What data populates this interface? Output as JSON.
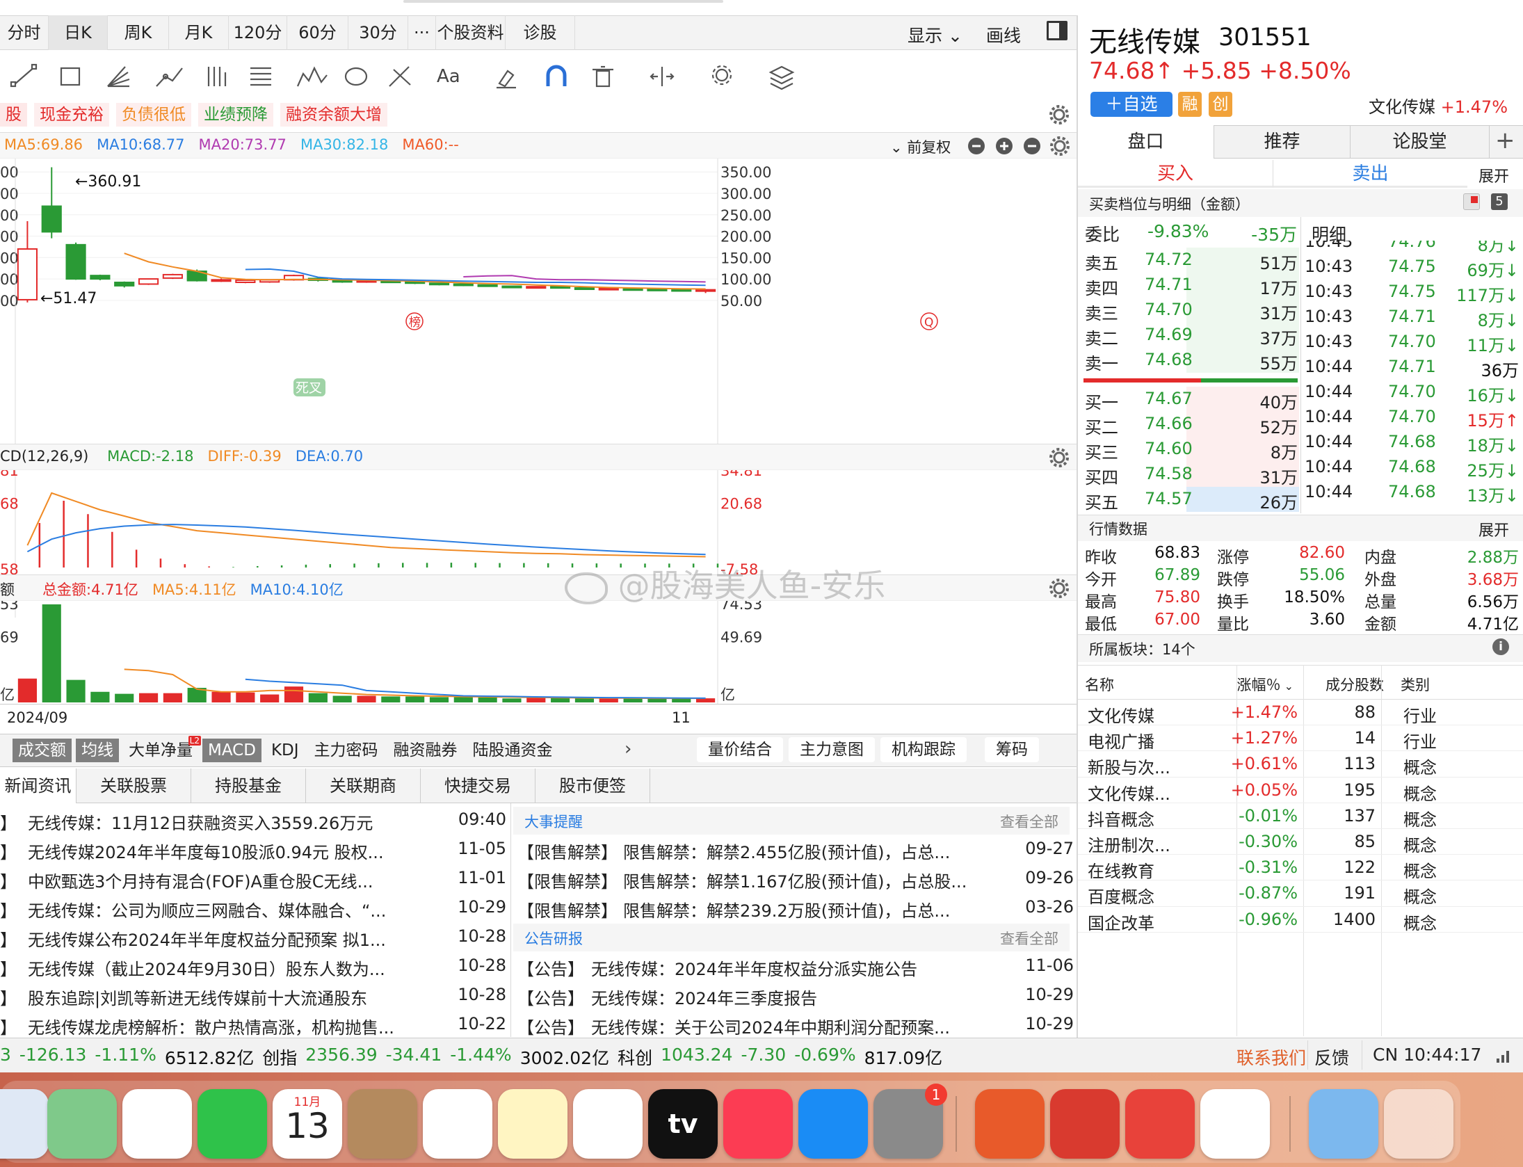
{
  "period_tabs": [
    "分时",
    "日K",
    "周K",
    "月K",
    "120分",
    "60分",
    "30分",
    "···",
    "个股资料",
    "诊股"
  ],
  "toolbar_right": {
    "display": "显示",
    "draw": "画线"
  },
  "tags": [
    "股",
    "现金充裕",
    "负债很低",
    "业绩预降",
    "融资余额大增"
  ],
  "ma": {
    "ma5": "MA5:69.86",
    "ma10": "MA10:68.77",
    "ma20": "MA20:73.77",
    "ma30": "MA30:82.18",
    "ma60": "MA60:--",
    "adjust": "前复权"
  },
  "kline": {
    "high_label": "←360.91",
    "low_label": "←51.47",
    "axis": [
      "350.00",
      "300.00",
      "250.00",
      "200.00",
      "150.00",
      "100.00",
      "50.00"
    ],
    "left_axis": [
      "00",
      "00",
      "00",
      "00",
      "00",
      "00",
      "00"
    ],
    "marker1": "榜",
    "marker2": "Q"
  },
  "macd": {
    "title": "CD(12,26,9)",
    "macd": "MACD:-2.18",
    "diff": "DIFF:-0.39",
    "dea": "DEA:0.70",
    "axis": [
      "34.81",
      "20.68",
      "-7.58"
    ],
    "left_axis": [
      "81",
      "68",
      "58"
    ],
    "cross": "死叉"
  },
  "volume": {
    "title": "额",
    "total": "总金额:4.71亿",
    "ma5": "MA5:4.11亿",
    "ma10": "MA10:4.10亿",
    "axis": [
      "74.53",
      "49.69",
      "亿"
    ],
    "left_axis": [
      "53",
      "69",
      "亿"
    ]
  },
  "x_axis": [
    "2024/09",
    "11"
  ],
  "indicator_tabs": [
    "成交额",
    "均线",
    "大单净量",
    "MACD",
    "KDJ",
    "主力密码",
    "融资融券",
    "陆股通资金"
  ],
  "indicator_badge": "L2",
  "indicator_right": [
    "量价结合",
    "主力意图",
    "机构跟踪",
    "筹码"
  ],
  "news_tabs": [
    "新闻资讯",
    "关联股票",
    "持股基金",
    "关联期商",
    "快捷交易",
    "股市便签"
  ],
  "news": [
    {
      "title": "无线传媒：11月12日获融资买入3559.26万元",
      "date": "09:40"
    },
    {
      "title": "无线传媒2024年半年度每10股派0.94元 股权...",
      "date": "11-05"
    },
    {
      "title": "中欧甄选3个月持有混合(FOF)A重仓股C无线...",
      "date": "11-01"
    },
    {
      "title": "无线传媒：公司为顺应三网融合、媒体融合、“...",
      "date": "10-29"
    },
    {
      "title": "无线传媒公布2024年半年度权益分配预案 拟1...",
      "date": "10-28"
    },
    {
      "title": "无线传媒（截止2024年9月30日）股东人数为...",
      "date": "10-28"
    },
    {
      "title": "股东追踪|刘凯等新进无线传媒前十大流通股东",
      "date": "10-28"
    },
    {
      "title": "无线传媒龙虎榜解析：散户热情高涨，机构抛售...",
      "date": "10-22"
    }
  ],
  "events": {
    "title": "大事提醒",
    "more": "查看全部",
    "items": [
      {
        "tag": "【限售解禁】",
        "text": "限售解禁：解禁2.455亿股(预计值)，占总...",
        "date": "09-27"
      },
      {
        "tag": "【限售解禁】",
        "text": "限售解禁：解禁1.167亿股(预计值)，占总股...",
        "date": "09-26"
      },
      {
        "tag": "【限售解禁】",
        "text": "限售解禁：解禁239.2万股(预计值)，占总...",
        "date": "03-26"
      }
    ]
  },
  "notices": {
    "title": "公告研报",
    "more": "查看全部",
    "items": [
      {
        "tag": "【公告】",
        "text": "无线传媒：2024年半年度权益分派实施公告",
        "date": "11-06"
      },
      {
        "tag": "【公告】",
        "text": "无线传媒：2024年三季度报告",
        "date": "10-29"
      },
      {
        "tag": "【公告】",
        "text": "无线传媒：关于公司2024年中期利润分配预案...",
        "date": "10-29"
      }
    ]
  },
  "stock": {
    "name": "无线传媒",
    "code": "301551",
    "price": "74.68↑",
    "change": "+5.85",
    "pct": "+8.50%",
    "add_watch": "＋自选",
    "badge1": "融",
    "badge2": "创",
    "sector": "文化传媒",
    "sector_pct": "+1.47%"
  },
  "right_tabs": [
    "盘口",
    "推荐",
    "论股堂"
  ],
  "buy": "买入",
  "sell": "卖出",
  "expand": "展开",
  "book_title": "买卖档位与明细（金额）",
  "book_count": "5",
  "weibi": {
    "label": "委比",
    "pct": "-9.83%",
    "amt": "-35万"
  },
  "detail_title": "明细",
  "asks": [
    {
      "l": "卖五",
      "p": "74.72",
      "v": "51万"
    },
    {
      "l": "卖四",
      "p": "74.71",
      "v": "17万"
    },
    {
      "l": "卖三",
      "p": "74.70",
      "v": "31万"
    },
    {
      "l": "卖二",
      "p": "74.69",
      "v": "37万"
    },
    {
      "l": "卖一",
      "p": "74.68",
      "v": "55万"
    }
  ],
  "bids": [
    {
      "l": "买一",
      "p": "74.67",
      "v": "40万"
    },
    {
      "l": "买二",
      "p": "74.66",
      "v": "52万"
    },
    {
      "l": "买三",
      "p": "74.60",
      "v": "8万"
    },
    {
      "l": "买四",
      "p": "74.58",
      "v": "31万"
    },
    {
      "l": "买五",
      "p": "74.57",
      "v": "26万"
    }
  ],
  "ticks": [
    {
      "t": "10:43",
      "p": "74.76",
      "v": "8万↓",
      "c": "green"
    },
    {
      "t": "10:43",
      "p": "74.75",
      "v": "69万↓",
      "c": "green"
    },
    {
      "t": "10:43",
      "p": "74.75",
      "v": "117万↓",
      "c": "green"
    },
    {
      "t": "10:43",
      "p": "74.71",
      "v": "8万↓",
      "c": "green"
    },
    {
      "t": "10:43",
      "p": "74.70",
      "v": "11万↓",
      "c": "green"
    },
    {
      "t": "10:44",
      "p": "74.71",
      "v": "36万",
      "c": "black"
    },
    {
      "t": "10:44",
      "p": "74.70",
      "v": "16万↓",
      "c": "green"
    },
    {
      "t": "10:44",
      "p": "74.70",
      "v": "15万↑",
      "c": "red"
    },
    {
      "t": "10:44",
      "p": "74.68",
      "v": "18万↓",
      "c": "green"
    },
    {
      "t": "10:44",
      "p": "74.68",
      "v": "25万↓",
      "c": "green"
    },
    {
      "t": "10:44",
      "p": "74.68",
      "v": "13万↓",
      "c": "green"
    }
  ],
  "quote": {
    "title": "行情数据",
    "expand": "展开",
    "rows": [
      [
        {
          "k": "昨收",
          "v": "68.83",
          "c": "black"
        },
        {
          "k": "涨停",
          "v": "82.60",
          "c": "red"
        },
        {
          "k": "内盘",
          "v": "2.88万",
          "c": "green"
        }
      ],
      [
        {
          "k": "今开",
          "v": "67.89",
          "c": "green"
        },
        {
          "k": "跌停",
          "v": "55.06",
          "c": "green"
        },
        {
          "k": "外盘",
          "v": "3.68万",
          "c": "red"
        }
      ],
      [
        {
          "k": "最高",
          "v": "75.80",
          "c": "red"
        },
        {
          "k": "换手",
          "v": "18.50%",
          "c": "black"
        },
        {
          "k": "总量",
          "v": "6.56万",
          "c": "black"
        }
      ],
      [
        {
          "k": "最低",
          "v": "67.00",
          "c": "red"
        },
        {
          "k": "量比",
          "v": "3.60",
          "c": "black"
        },
        {
          "k": "金额",
          "v": "4.71亿",
          "c": "black"
        }
      ]
    ]
  },
  "sectors": {
    "title": "所属板块：14个",
    "cols": [
      "名称",
      "涨幅％",
      "成分股数",
      "类别"
    ],
    "rows": [
      {
        "n": "文化传媒",
        "p": "+1.47%",
        "c": "88",
        "t": "行业",
        "pc": "red"
      },
      {
        "n": "电视广播",
        "p": "+1.27%",
        "c": "14",
        "t": "行业",
        "pc": "red"
      },
      {
        "n": "新股与次...",
        "p": "+0.61%",
        "c": "113",
        "t": "概念",
        "pc": "red"
      },
      {
        "n": "文化传媒...",
        "p": "+0.05%",
        "c": "195",
        "t": "概念",
        "pc": "red"
      },
      {
        "n": "抖音概念",
        "p": "-0.01%",
        "c": "137",
        "t": "概念",
        "pc": "green"
      },
      {
        "n": "注册制次...",
        "p": "-0.30%",
        "c": "85",
        "t": "概念",
        "pc": "green"
      },
      {
        "n": "在线教育",
        "p": "-0.31%",
        "c": "122",
        "t": "概念",
        "pc": "green"
      },
      {
        "n": "百度概念",
        "p": "-0.87%",
        "c": "191",
        "t": "概念",
        "pc": "green"
      },
      {
        "n": "国企改革",
        "p": "-0.96%",
        "c": "1400",
        "t": "概念",
        "pc": "green"
      }
    ]
  },
  "ticker": {
    "items": [
      {
        "t": "3",
        "c": "green"
      },
      {
        "t": "-126.13",
        "c": "green"
      },
      {
        "t": "-1.11%",
        "c": "green"
      },
      {
        "t": "6512.82亿",
        "c": "black"
      },
      {
        "t": "创指",
        "c": "black"
      },
      {
        "t": "2356.39",
        "c": "green"
      },
      {
        "t": "-34.41",
        "c": "green"
      },
      {
        "t": "-1.44%",
        "c": "green"
      },
      {
        "t": "3002.02亿",
        "c": "black"
      },
      {
        "t": "科创",
        "c": "black"
      },
      {
        "t": "1043.24",
        "c": "green"
      },
      {
        "t": "-7.30",
        "c": "green"
      },
      {
        "t": "-0.69%",
        "c": "green"
      },
      {
        "t": "817.09亿",
        "c": "black"
      }
    ],
    "contact": "联系我们",
    "feedback": "反馈",
    "clock": "CN 10:44:17"
  },
  "watermark": "@股海美人鱼-安乐",
  "dock": {
    "calendar_month": "11月",
    "calendar_day": "13",
    "settings_badge": "1",
    "tv": "tv"
  },
  "colors": {
    "up": "#e32b2b",
    "down": "#2a9a35",
    "ma5": "#f08a24",
    "ma10": "#2a7de1",
    "ma20": "#b03ab0",
    "ma30": "#34b5e6",
    "ma60": "#f05a28"
  }
}
